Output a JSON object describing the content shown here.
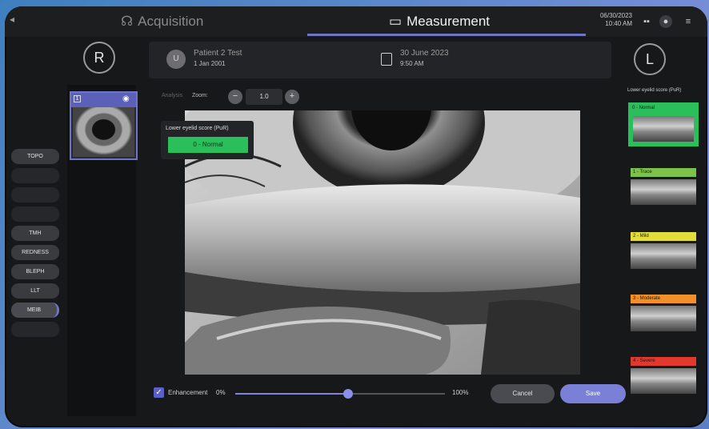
{
  "topbar": {
    "tab_acquisition": "Acquisition",
    "tab_measurement": "Measurement",
    "date": "06/30/2023",
    "time": "10:40 AM"
  },
  "patient": {
    "initial": "U",
    "name": "Patient 2 Test",
    "dob": "1 Jan 2001",
    "exam_date": "30 June 2023",
    "exam_time": "9:50 AM"
  },
  "eyes": {
    "right": "R",
    "left": "L"
  },
  "nav": {
    "items": [
      {
        "label": "TOPO",
        "state": "normal"
      },
      {
        "label": "",
        "state": "dim"
      },
      {
        "label": "",
        "state": "dim"
      },
      {
        "label": "",
        "state": "dim"
      },
      {
        "label": "TMH",
        "state": "normal"
      },
      {
        "label": "REDNESS",
        "state": "normal"
      },
      {
        "label": "BLEPH",
        "state": "normal"
      },
      {
        "label": "LLT",
        "state": "normal"
      },
      {
        "label": "MEIB",
        "state": "active"
      },
      {
        "label": "",
        "state": "dim"
      }
    ]
  },
  "toolbar": {
    "analysis_label": "Analysis",
    "zoom_label": "Zoom:",
    "zoom_value": "1.0",
    "minus": "−",
    "plus": "+"
  },
  "score_overlay": {
    "label": "Lower eyelid score (PuR)",
    "value": "0 - Normal"
  },
  "enhancement": {
    "label": "Enhancement",
    "min": "0%",
    "max": "100%",
    "value_fraction": 0.54
  },
  "buttons": {
    "cancel": "Cancel",
    "save": "Save"
  },
  "grading": {
    "title": "Lower eyelid score (PuR)",
    "grades": [
      {
        "label": "0 - Normal",
        "color": "#2bbf5c",
        "selected": true
      },
      {
        "label": "1 - Trace",
        "color": "#7cc24a",
        "selected": false
      },
      {
        "label": "2 - Mild",
        "color": "#e2dd3a",
        "selected": false
      },
      {
        "label": "3 - Moderate",
        "color": "#f0902a",
        "selected": false
      },
      {
        "label": "4 - Severe",
        "color": "#e2392f",
        "selected": false
      }
    ]
  },
  "colors": {
    "accent": "#6f74c9",
    "normal_green": "#2bbf5c"
  }
}
